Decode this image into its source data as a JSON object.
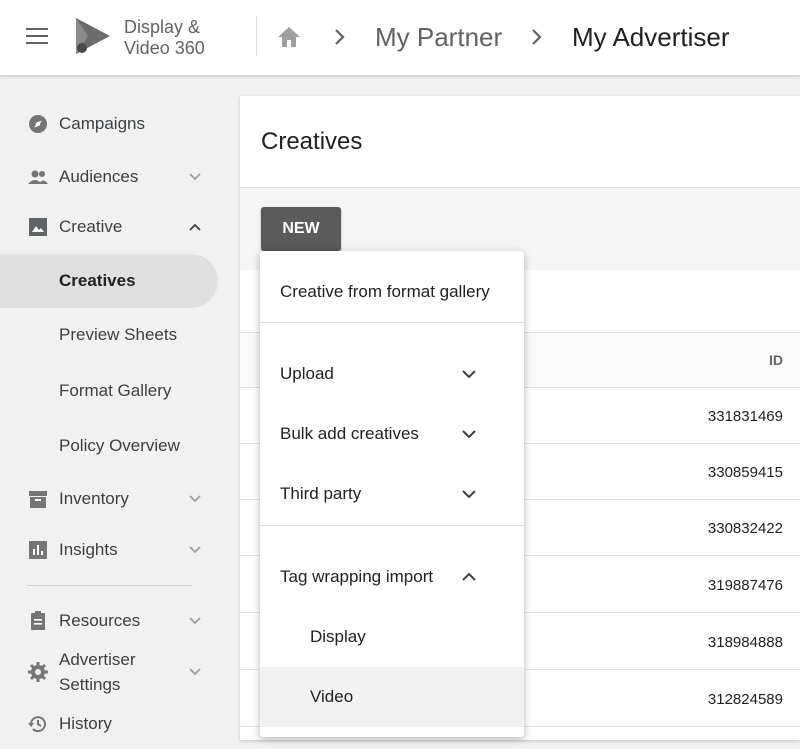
{
  "header": {
    "brand_line1": "Display &",
    "brand_line2": "Video 360",
    "breadcrumb": [
      "My Partner",
      "My Advertiser"
    ]
  },
  "sidebar": {
    "items": [
      {
        "label": "Campaigns",
        "icon": "compass-icon"
      },
      {
        "label": "Audiences",
        "icon": "people-icon",
        "expand": "chevron-down"
      },
      {
        "label": "Creative",
        "icon": "image-icon",
        "expand": "chevron-up"
      },
      {
        "label": "Creatives",
        "active": true
      },
      {
        "label": "Preview Sheets"
      },
      {
        "label": "Format Gallery"
      },
      {
        "label": "Policy Overview"
      },
      {
        "label": "Inventory",
        "icon": "archive-icon",
        "expand": "chevron-down"
      },
      {
        "label": "Insights",
        "icon": "bar-chart-icon",
        "expand": "chevron-down"
      },
      {
        "label": "Resources",
        "icon": "clipboard-icon",
        "expand": "chevron-down"
      },
      {
        "label": "Advertiser Settings",
        "line1": "Advertiser",
        "line2": "Settings",
        "icon": "gear-icon",
        "expand": "chevron-down"
      },
      {
        "label": "History",
        "icon": "history-icon"
      }
    ]
  },
  "main": {
    "title": "Creatives",
    "new_button": "NEW",
    "table": {
      "id_header": "ID",
      "rows": [
        "331831469",
        "330859415",
        "330832422",
        "319887476",
        "318984888",
        "312824589"
      ]
    }
  },
  "menu": {
    "items": [
      {
        "label": "Creative from format gallery"
      },
      {
        "label": "Upload",
        "expand": "chevron-down"
      },
      {
        "label": "Bulk add creatives",
        "expand": "chevron-down"
      },
      {
        "label": "Third party",
        "expand": "chevron-down"
      },
      {
        "label": "Tag wrapping import",
        "expand": "chevron-up"
      },
      {
        "label": "Display",
        "sub": true
      },
      {
        "label": "Video",
        "sub": true,
        "highlighted": true
      }
    ]
  },
  "colors": {
    "page_bg": "#f1f1f1",
    "button_bg": "#5a5a5a",
    "active_nav": "#e0e0e0",
    "text": "#202124",
    "muted": "#5f6368"
  }
}
